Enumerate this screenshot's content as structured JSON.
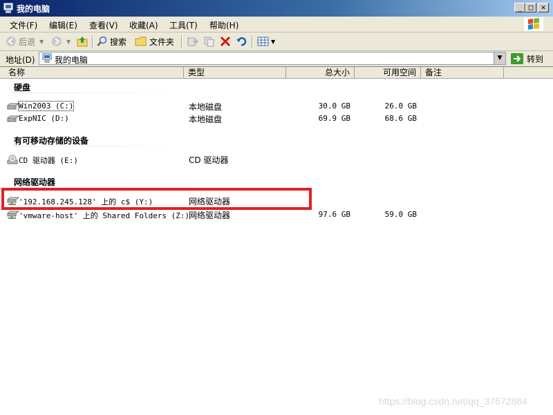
{
  "window": {
    "title": "我的电脑",
    "min": "_",
    "max": "□",
    "close": "✕"
  },
  "menu": [
    "文件(F)",
    "编辑(E)",
    "查看(V)",
    "收藏(A)",
    "工具(T)",
    "帮助(H)"
  ],
  "toolbar": {
    "back": "后退",
    "search": "搜索",
    "folders": "文件夹"
  },
  "address": {
    "label": "地址(D)",
    "value": "我的电脑",
    "go": "转到"
  },
  "columns": {
    "name": "名称",
    "type": "类型",
    "total": "总大小",
    "free": "可用空间",
    "note": "备注"
  },
  "groups": {
    "hdd": {
      "title": "硬盘",
      "items": [
        {
          "name": "Win2003 (C:)",
          "type": "本地磁盘",
          "total": "30.0 GB",
          "free": "26.0 GB"
        },
        {
          "name": "ExpNIC (D:)",
          "type": "本地磁盘",
          "total": "69.9 GB",
          "free": "68.6 GB"
        }
      ]
    },
    "removable": {
      "title": "有可移动存储的设备",
      "items": [
        {
          "name": "CD 驱动器 (E:)",
          "type": "CD 驱动器"
        }
      ]
    },
    "network": {
      "title": "网络驱动器",
      "items": [
        {
          "name": "'192.168.245.128' 上的 c$ (Y:)",
          "type": "网络驱动器"
        },
        {
          "name": "'vmware-host' 上的 Shared Folders (Z:)",
          "type": "网络驱动器",
          "total": "97.6 GB",
          "free": "59.0 GB"
        }
      ]
    }
  },
  "watermark": "https://blog.csdn.net/qq_37672864",
  "colors": {
    "highlight": "#e21f26",
    "titlebar": "#0a246a"
  }
}
